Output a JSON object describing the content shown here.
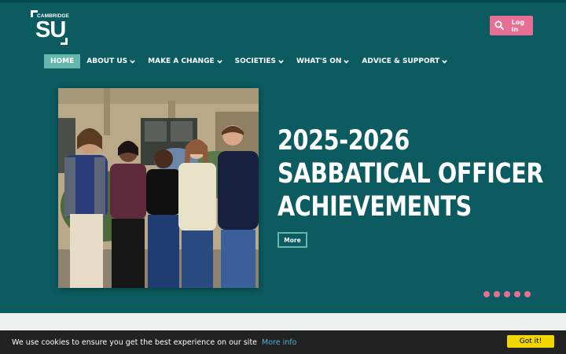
{
  "logo": {
    "small": "CAMBRIDGE",
    "big": "SU"
  },
  "header": {
    "login_label": "Log in",
    "search_icon": "search-icon"
  },
  "nav": {
    "items": [
      {
        "label": "HOME",
        "active": true
      },
      {
        "label": "ABOUT US",
        "dropdown": true
      },
      {
        "label": "MAKE A CHANGE",
        "dropdown": true
      },
      {
        "label": "SOCIETIES",
        "dropdown": true
      },
      {
        "label": "WHAT'S ON",
        "dropdown": true
      },
      {
        "label": "ADVICE & SUPPORT",
        "dropdown": true
      }
    ]
  },
  "hero": {
    "headline_lines": [
      "2025-2026",
      "SABBATICAL OFFICER",
      "ACHIEVEMENTS"
    ],
    "more_label": "More",
    "slide_count": 5
  },
  "cookie": {
    "message": "We use cookies to ensure you get the best experience on our site",
    "more_info": "More info",
    "accept_label": "Got it!"
  },
  "colors": {
    "hero_bg": "#0b5b60",
    "accent_pink": "#e86f93",
    "accent_teal": "#63b8ab",
    "cookie_bg": "#222222",
    "cookie_button": "#f1d600"
  }
}
